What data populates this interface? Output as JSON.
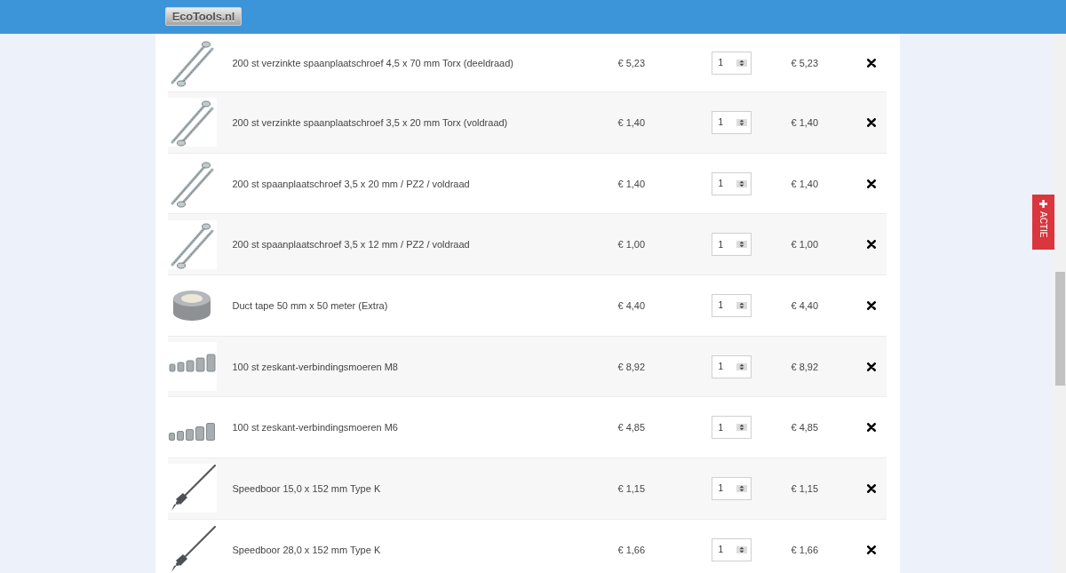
{
  "header": {
    "logo": "EcoTools.nl"
  },
  "promo_tab": {
    "label": "ACTIE"
  },
  "cart": {
    "rows": [
      {
        "kind": "screw",
        "name": "200 st verzinkte spaanplaatschroef 4,5 x 70 mm Torx (deeldraad)",
        "price": "€ 5,23",
        "quantity": "1",
        "total": "€ 5,23"
      },
      {
        "kind": "screw",
        "name": "200 st verzinkte spaanplaatschroef 3,5 x 20 mm Torx (voldraad)",
        "price": "€ 1,40",
        "quantity": "1",
        "total": "€ 1,40"
      },
      {
        "kind": "screw",
        "name": "200 st spaanplaatschroef 3,5 x 20 mm / PZ2 / voldraad",
        "price": "€ 1,40",
        "quantity": "1",
        "total": "€ 1,40"
      },
      {
        "kind": "screw",
        "name": "200 st spaanplaatschroef 3,5 x 12 mm / PZ2 / voldraad",
        "price": "€ 1,00",
        "quantity": "1",
        "total": "€ 1,00"
      },
      {
        "kind": "tape",
        "name": "Duct tape 50 mm x 50 meter (Extra)",
        "price": "€ 4,40",
        "quantity": "1",
        "total": "€ 4,40"
      },
      {
        "kind": "nut",
        "name": "100 st zeskant-verbindingsmoeren M8",
        "price": "€ 8,92",
        "quantity": "1",
        "total": "€ 8,92"
      },
      {
        "kind": "nut",
        "name": "100 st zeskant-verbindingsmoeren M6",
        "price": "€ 4,85",
        "quantity": "1",
        "total": "€ 4,85"
      },
      {
        "kind": "drill",
        "name": "Speedboor 15,0 x 152 mm Type K",
        "price": "€ 1,15",
        "quantity": "1",
        "total": "€ 1,15"
      },
      {
        "kind": "drill",
        "name": "Speedboor 28,0 x 152 mm Type K",
        "price": "€ 1,66",
        "quantity": "1",
        "total": "€ 1,66"
      }
    ]
  }
}
